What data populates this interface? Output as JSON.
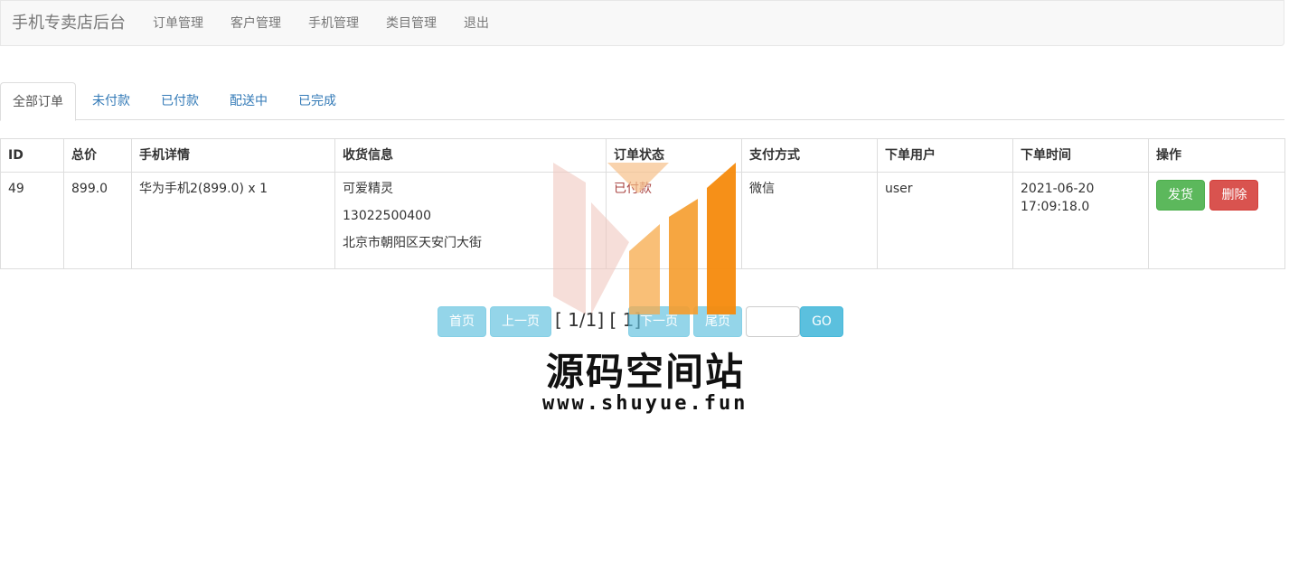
{
  "navbar": {
    "brand": "手机专卖店后台",
    "links": [
      "订单管理",
      "客户管理",
      "手机管理",
      "类目管理",
      "退出"
    ]
  },
  "tabs": [
    "全部订单",
    "未付款",
    "已付款",
    "配送中",
    "已完成"
  ],
  "table": {
    "headers": [
      "ID",
      "总价",
      "手机详情",
      "收货信息",
      "订单状态",
      "支付方式",
      "下单用户",
      "下单时间",
      "操作"
    ],
    "rows": [
      {
        "id": "49",
        "total": "899.0",
        "detail": "华为手机2(899.0) x 1",
        "receiver_name": "可爱精灵",
        "receiver_phone": "13022500400",
        "receiver_address": "北京市朝阳区天安门大街",
        "status": "已付款",
        "payment": "微信",
        "user": "user",
        "date": "2021-06-20",
        "time": "17:09:18.0",
        "actions": {
          "ship": "发货",
          "delete": "删除"
        }
      }
    ]
  },
  "pagination": {
    "first": "首页",
    "prev": "上一页",
    "info": "[ 1/1] [ 1]",
    "next": "下一页",
    "last": "尾页",
    "input_value": "",
    "go": "GO"
  },
  "watermark": {
    "title": "源码空间站",
    "url": "www.shuyue.fun"
  },
  "colors": {
    "link": "#337ab7",
    "status_paid": "#a94442",
    "success": "#5cb85c",
    "danger": "#d9534f",
    "info": "#5bc0de"
  }
}
